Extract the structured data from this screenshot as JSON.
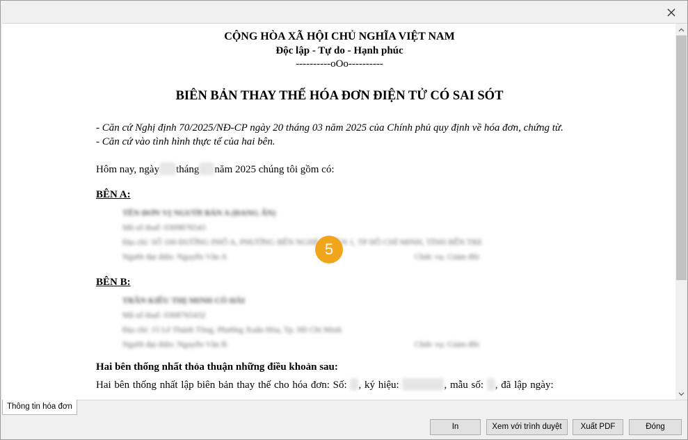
{
  "document": {
    "header_line1": "CỘNG HÒA XÃ HỘI CHỦ NGHĨA VIỆT NAM",
    "header_line2": "Độc lập - Tự do - Hạnh phúc",
    "header_line3": "----------oOo----------",
    "title": "BIÊN BẢN THAY THẾ HÓA ĐƠN ĐIỆN TỬ CÓ SAI SÓT",
    "basis1": "- Căn cứ Nghị định 70/2025/NĐ-CP ngày 20 tháng 03 năm 2025 của Chính phủ quy định về hóa đơn, chứng từ.",
    "basis2": "- Căn cứ vào tình hình thực tế của hai bên.",
    "today_prefix": "Hôm nay, ngày",
    "today_month": "tháng",
    "today_suffix": "năm 2025 chúng tôi gồm có:",
    "party_a_heading": "BÊN A:",
    "party_a_name": "TÊN ĐƠN VỊ NGƯỜI BÁN A (ĐANG ẨN)",
    "party_a_tax": "Mã số thuế: 0309876543",
    "party_a_address": "Địa chỉ: SỐ 100 ĐƯỜNG PHỐ A, PHƯỜNG BẾN NGHÉ, QUẬN 1, TP HỒ CHÍ MINH, TỈNH BẾN TRE",
    "party_a_rep": "Người đại diện: Nguyễn Văn A",
    "party_a_pos": "Chức vụ: Giám đốc",
    "party_b_heading": "BÊN B:",
    "party_b_name": "TRẦN KIỀU THỊ MINH CÔ HẢI",
    "party_b_tax": "Mã số thuế: 0308765432",
    "party_b_address": "Địa chỉ: 15 Lê Thánh Tông, Phường Xuân Hòa, Tp. Hồ Chí Minh",
    "party_b_rep": "Người đại diện: Nguyễn Văn B",
    "party_b_pos": "Chức vụ: Giám đốc",
    "agree_heading": "Hai bên thống nhất thỏa thuận những điều khoản sau:",
    "agree_text_1": "Hai bên thống nhất lập biên bản thay thế cho hóa đơn: Số:",
    "agree_text_2": ", ký hiệu:",
    "agree_text_3": ", mẫu số:",
    "agree_text_4": ", đã lập ngày:"
  },
  "badge": "5",
  "tab_label": "Thông tin hóa đơn",
  "buttons": {
    "print": "In",
    "browser": "Xem với trình duyệt",
    "pdf": "Xuất PDF",
    "close": "Đóng"
  },
  "icons": {
    "close": "close-icon",
    "scroll_up": "chevron-up-icon",
    "scroll_down": "chevron-down-icon"
  },
  "colors": {
    "badge": "#f0a51c",
    "scroll_thumb": "#c2c2c2"
  }
}
